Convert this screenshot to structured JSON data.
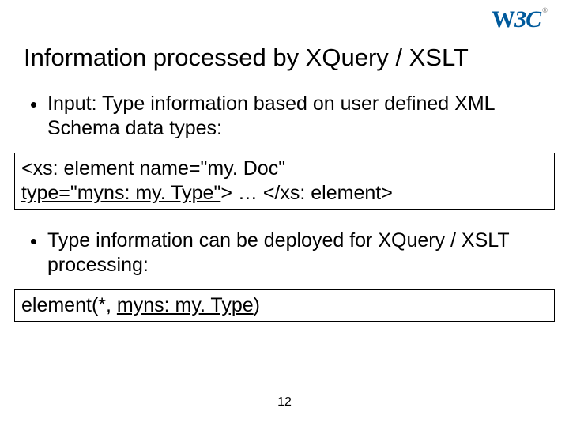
{
  "logo": {
    "text": "W3C",
    "reg": "®"
  },
  "title": "Information processed by XQuery / XSLT",
  "bullet1": "Input: Type information based on user defined XML Schema data types:",
  "code1": {
    "line1": "<xs: element name=\"my. Doc\"",
    "line2_a": "type=\"myns: my. Type\"",
    "line2_b": "> … </xs: element>"
  },
  "bullet2_a": "Type information",
  "bullet2_b": " can be deployed for XQuery / XSLT processing:",
  "code2": {
    "a": "element(*, ",
    "b": "myns: my. Type",
    "c": ")"
  },
  "page": "12"
}
